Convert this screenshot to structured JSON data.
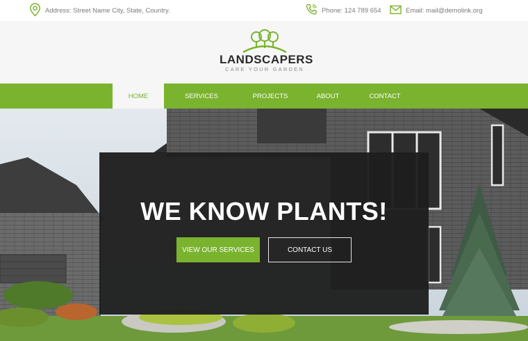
{
  "topbar": {
    "address": "Address: Street Name City, State, Country.",
    "phone": "Phone: 124 789 654",
    "email": "Email: mail@demolink.org"
  },
  "logo": {
    "title": "LANDSCAPERS",
    "tagline": "CARE YOUR GARDEN"
  },
  "nav": {
    "items": [
      {
        "label": "HOME",
        "active": true
      },
      {
        "label": "SERVICES",
        "active": false
      },
      {
        "label": "PROJECTS",
        "active": false
      },
      {
        "label": "ABOUT",
        "active": false
      },
      {
        "label": "CONTACT",
        "active": false
      }
    ]
  },
  "hero": {
    "title": "WE KNOW PLANTS!",
    "primary_button": "VIEW OUR SERVICES",
    "secondary_button": "CONTACT US"
  },
  "colors": {
    "brand_green": "#7ab32e",
    "overlay": "#1e1e1e",
    "header_bg": "#f6f6f6"
  }
}
